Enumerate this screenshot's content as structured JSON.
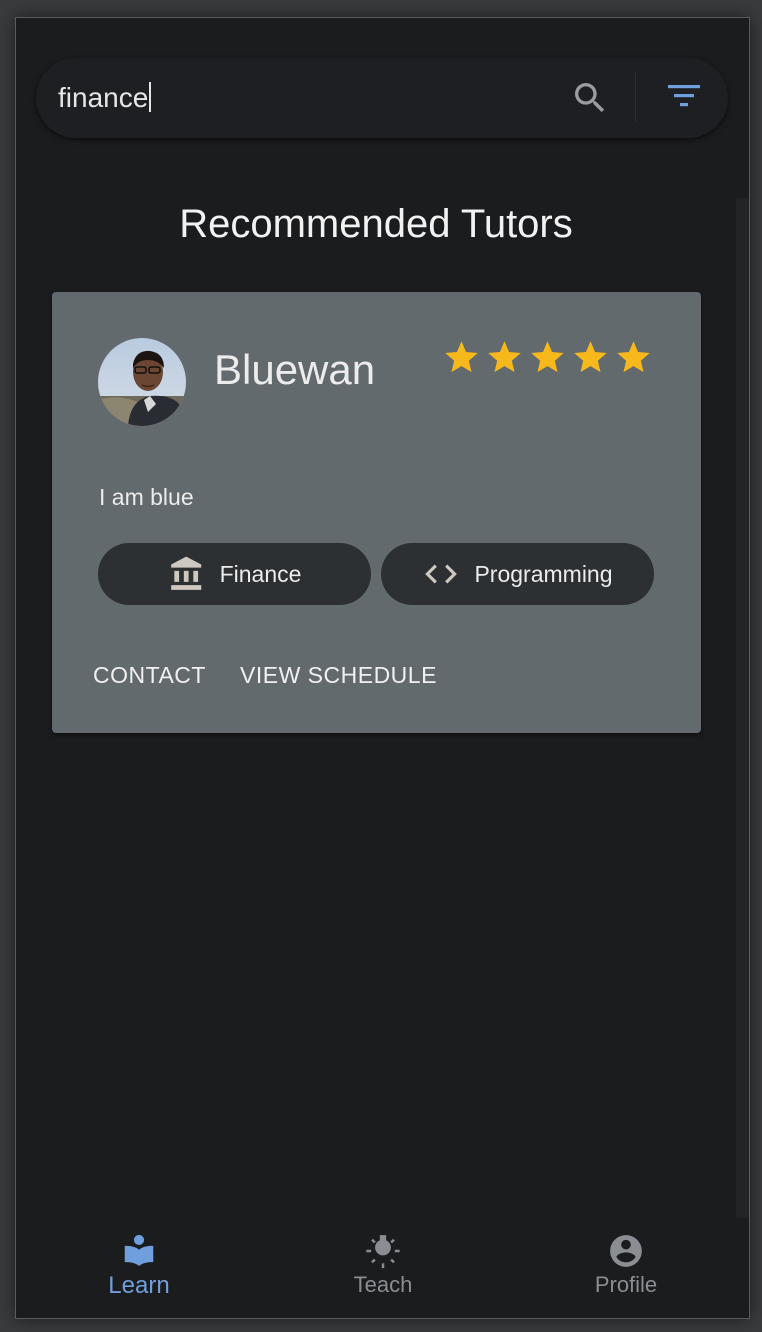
{
  "search": {
    "value": "finance"
  },
  "page_title": "Recommended Tutors",
  "tutor": {
    "name": "Bluewan",
    "rating": 5,
    "rating_max": 5,
    "bio": "I am blue",
    "subjects": [
      {
        "label": "Finance",
        "icon": "bank-icon"
      },
      {
        "label": "Programming",
        "icon": "code-icon"
      }
    ],
    "actions": {
      "contact": "CONTACT",
      "schedule": "VIEW SCHEDULE"
    }
  },
  "nav": {
    "items": [
      {
        "label": "Learn",
        "icon": "book-reader-icon",
        "active": true
      },
      {
        "label": "Teach",
        "icon": "lightbulb-icon",
        "active": false
      },
      {
        "label": "Profile",
        "icon": "account-circle-icon",
        "active": false
      }
    ]
  },
  "colors": {
    "background": "#1b1c1e",
    "card": "#626a6e",
    "chip": "#2c3033",
    "accent": "#6f9fdc",
    "star": "#f6b81a",
    "inactive": "#8a8d91"
  }
}
